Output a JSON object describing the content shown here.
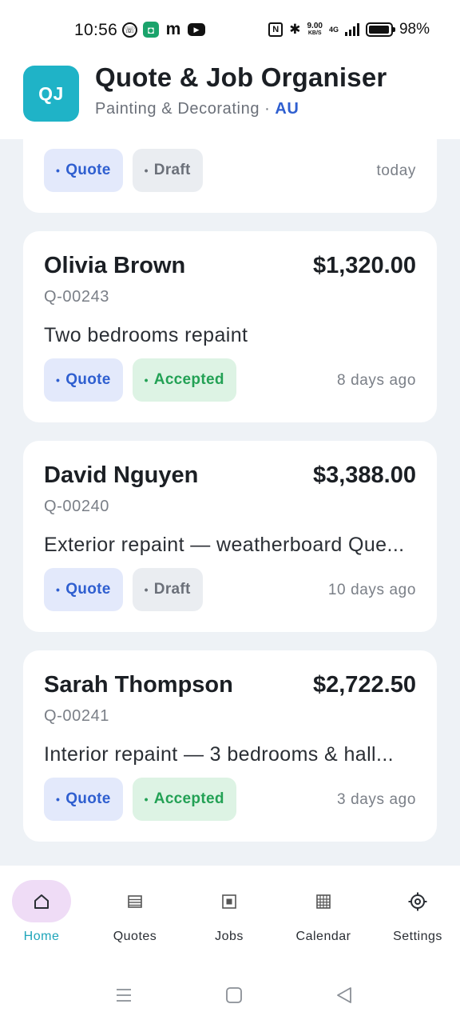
{
  "status_bar": {
    "time": "10:56",
    "left_icons": [
      "viber-icon",
      "shield-icon",
      "m-icon",
      "youtube-icon"
    ],
    "speed_value": "9.00",
    "speed_unit": "KB/S",
    "network": "4G",
    "battery_percent": "98%",
    "battery_level": 0.98
  },
  "header": {
    "logo_text": "QJ",
    "title": "Quote & Job Organiser",
    "subtitle": "Painting & Decorating",
    "separator": "·",
    "region": "AU"
  },
  "cards": [
    {
      "name": "",
      "amount": "",
      "id": "",
      "description": "",
      "type_badge": "Quote",
      "status_badge": "Draft",
      "time": "today"
    },
    {
      "name": "Olivia Brown",
      "amount": "$1,320.00",
      "id": "Q-00243",
      "description": "Two bedrooms repaint",
      "type_badge": "Quote",
      "status_badge": "Accepted",
      "time": "8 days ago"
    },
    {
      "name": "David Nguyen",
      "amount": "$3,388.00",
      "id": "Q-00240",
      "description": "Exterior repaint — weatherboard Que...",
      "type_badge": "Quote",
      "status_badge": "Draft",
      "time": "10 days ago"
    },
    {
      "name": "Sarah Thompson",
      "amount": "$2,722.50",
      "id": "Q-00241",
      "description": "Interior repaint — 3 bedrooms & hall...",
      "type_badge": "Quote",
      "status_badge": "Accepted",
      "time": "3 days ago"
    }
  ],
  "badge_dot": "•",
  "nav": {
    "items": [
      {
        "label": "Home",
        "icon": "home-icon",
        "active": true
      },
      {
        "label": "Quotes",
        "icon": "list-icon",
        "active": false
      },
      {
        "label": "Jobs",
        "icon": "job-icon",
        "active": false
      },
      {
        "label": "Calendar",
        "icon": "calendar-icon",
        "active": false
      },
      {
        "label": "Settings",
        "icon": "gear-icon",
        "active": false
      }
    ]
  },
  "system_nav": [
    "menu-icon",
    "home-square-icon",
    "back-triangle-icon"
  ],
  "colors": {
    "accent": "#1fb3c7",
    "quote_badge": "#2f5fd0",
    "accepted_badge": "#23a155",
    "draft_badge": "#6b7079",
    "home_active_pill": "#efdcf6"
  }
}
